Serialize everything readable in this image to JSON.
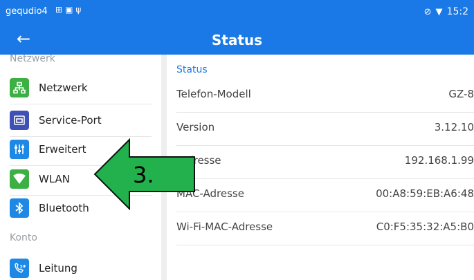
{
  "status_bar": {
    "device": "gequdio4",
    "left_icons": [
      "usb-connection-icon",
      "screenshot-icon",
      "usb-icon"
    ],
    "right_icons": [
      "mute-icon",
      "wifi-icon"
    ],
    "time": "15:2"
  },
  "app_bar": {
    "title": "Status",
    "back_icon": "arrow-left-icon"
  },
  "sidebar": {
    "section_top": "Netzwerk",
    "items": [
      {
        "label": "Netzwerk",
        "icon": "network-icon",
        "color": "#3cb043"
      },
      {
        "label": "Service-Port",
        "icon": "service-port-icon",
        "color": "#3f51b5"
      },
      {
        "label": "Erweitert",
        "icon": "sliders-icon",
        "color": "#1e88e5"
      },
      {
        "label": "WLAN",
        "icon": "wifi-icon",
        "color": "#3cb043"
      },
      {
        "label": "Bluetooth",
        "icon": "bluetooth-icon",
        "color": "#1e88e5"
      }
    ],
    "section_bottom": "Konto",
    "bottom_item": {
      "label": "Leitung",
      "icon": "sip-icon",
      "color": "#1e88e5"
    }
  },
  "content": {
    "heading": "Status",
    "rows": [
      {
        "key": "Telefon-Modell",
        "value": "GZ-8"
      },
      {
        "key": "Version",
        "value": "3.12.10"
      },
      {
        "key": "-Adresse",
        "value": "192.168.1.99"
      },
      {
        "key": "MAC-Adresse",
        "value": "00:A8:59:EB:A6:48"
      },
      {
        "key": "Wi-Fi-MAC-Adresse",
        "value": "C0:F5:35:32:A5:B0"
      }
    ]
  },
  "annotation": {
    "label": "3.",
    "color": "#22b14c"
  }
}
